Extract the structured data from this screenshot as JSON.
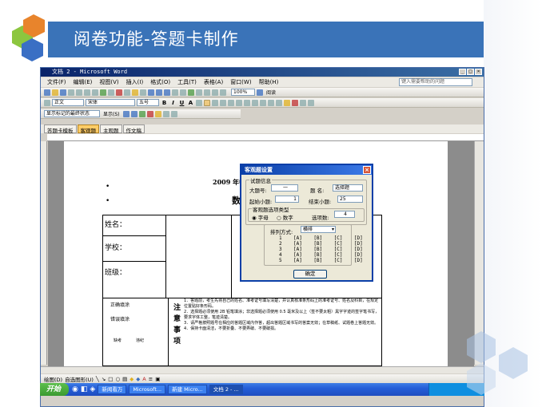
{
  "slide": {
    "title": "阅卷功能-答题卡制作",
    "colors": {
      "title_bar": "#3a73b8",
      "hex_blue": "#3a6fc4",
      "hex_green": "#8cc63f",
      "hex_orange": "#e8842c"
    }
  },
  "window": {
    "title": "文档 2 - Microsoft Word",
    "menus": [
      "文件(F)",
      "编辑(E)",
      "视图(V)",
      "插入(I)",
      "格式(O)",
      "工具(T)",
      "表格(A)",
      "窗口(W)",
      "帮助(H)"
    ],
    "help_placeholder": "键入需要帮助的问题",
    "style_value": "正文",
    "font_value": "宋体",
    "size_value": "五号",
    "zoom_value": "100%",
    "read_label": "阅读",
    "markup_label": "显示标记的最终状态",
    "show_label": "显示(S)",
    "tabs": [
      {
        "label": "答题卡模板",
        "active": false
      },
      {
        "label": "客观题",
        "active": true
      },
      {
        "label": "主观题",
        "active": false
      },
      {
        "label": "作文稿",
        "active": false
      }
    ],
    "draw_label": "绘图(D)",
    "autoshape_label": "自选图形(U)"
  },
  "document": {
    "exam_title": "2009 年中卫",
    "subject": "数学",
    "name_label": "姓名：",
    "school_label": "学校：",
    "class_label": "班级：",
    "correct_fill": "正确填涂",
    "wrong_fill": "错误填涂",
    "missing_label": "缺考",
    "violation_label": "违纪",
    "notice_chars": [
      "注",
      "意",
      "事",
      "项"
    ],
    "notices": [
      "1．答题前，考生先将自己的姓名、准考证号填写清楚，并认真核准条形码上的准考证号、姓名及科目，在规定位置贴好条形码。",
      "2．选择题必须使用 2B 铅笔填涂；非选择题必须使用 0.5 毫米及以上（签不要太粗）黑字字迹的签字笔书写，要求字体工整，笔迹清楚。",
      "3．请严格按照题号在相应的答题区域内作答，超出答题区域书写的答案无效；在草稿纸、试题卷上答题无效。",
      "4．保持卡面清洁，不要折叠、不要弄破、不要破损。"
    ]
  },
  "dialog": {
    "title": "客观题设置",
    "group_info": "试题信息",
    "big_no_label": "大题号:",
    "big_no_value": "一",
    "name_label": "题  名:",
    "name_value": "选择题",
    "start_label": "起始小题:",
    "start_value": "1",
    "end_label": "结束小题:",
    "end_value": "25",
    "group_type": "客观题选项类型",
    "radio_letter": "字母",
    "radio_digit": "数字",
    "options_label": "选项数:",
    "options_value": "4",
    "sort_label": "排列方式:",
    "sort_value": "横排",
    "rows": [
      "1    [A]    [B]    [C]    [D]",
      "2    [A]    [B]    [C]    [D]",
      "3    [A]    [B]    [C]    [D]",
      "4    [A]    [B]    [C]    [D]",
      "5    [A]    [B]    [C]    [D]"
    ],
    "ok_label": "确定"
  },
  "taskbar": {
    "start_label": "开始",
    "items": [
      {
        "label": "新闻看万",
        "active": false
      },
      {
        "label": "Microsoft...",
        "active": false
      },
      {
        "label": "新建 Micro...",
        "active": false
      },
      {
        "label": "文档 2 - ...",
        "active": true
      }
    ]
  }
}
